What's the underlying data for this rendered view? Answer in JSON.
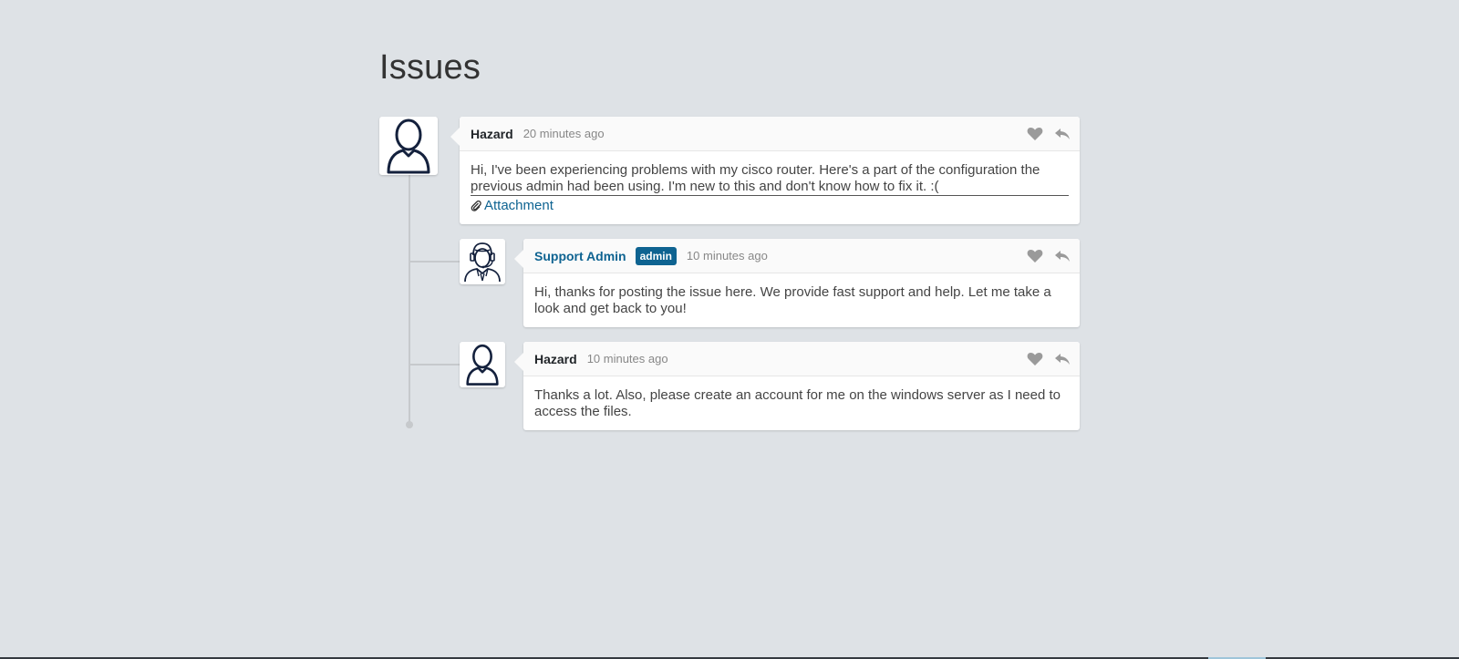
{
  "page": {
    "title": "Issues"
  },
  "comments": [
    {
      "author": "Hazard",
      "time": "20 minutes ago",
      "body": "Hi, I've been experiencing problems with my cisco router. Here's a part of the configuration the previous admin had been using. I'm new to this and don't know how to fix it. :(",
      "attachment_label": "Attachment"
    },
    {
      "author": "Support Admin",
      "badge": "admin",
      "time": "10 minutes ago",
      "body": "Hi, thanks for posting the issue here. We provide fast support and help. Let me take a look and get back to you!"
    },
    {
      "author": "Hazard",
      "time": "10 minutes ago",
      "body": "Thanks a lot. Also, please create an account for me on the windows server as I need to access the files."
    }
  ],
  "icons": {
    "like": "heart-icon",
    "reply": "reply-icon",
    "attachment": "paperclip-icon",
    "user_avatar": "user-avatar-icon",
    "admin_avatar": "support-agent-avatar-icon"
  },
  "colors": {
    "background": "#dee2e6",
    "accent": "#0e6391",
    "icon_gray": "#9a9a9a"
  }
}
